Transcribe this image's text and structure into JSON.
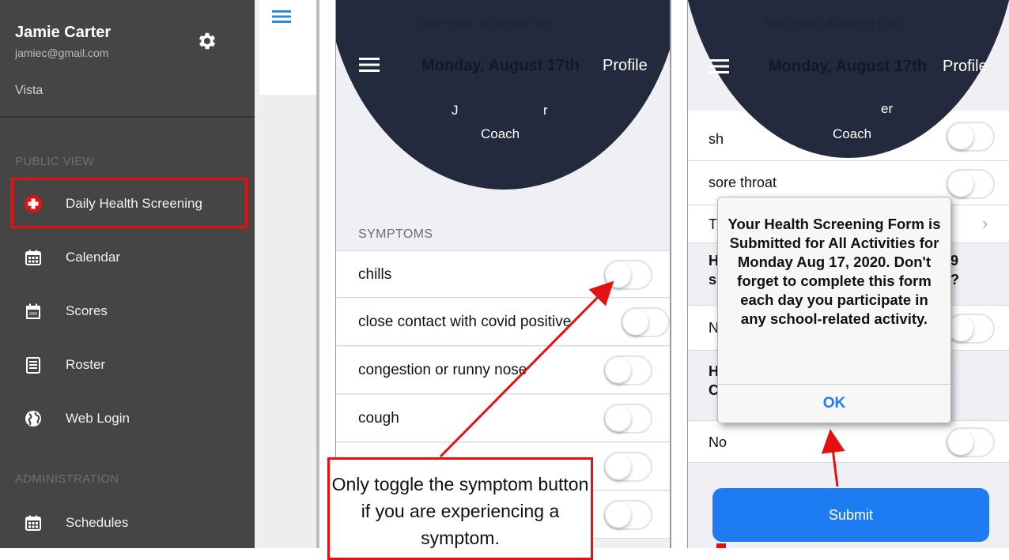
{
  "colors": {
    "sidebar_bg": "#454545",
    "header_navy": "#242a3e",
    "accent_red": "#e51010",
    "accent_blue": "#1e7cf2",
    "grouped_bg": "#efeff4"
  },
  "sidebar": {
    "user_name": "Jamie Carter",
    "user_email": "jamiec@gmail.com",
    "org": "Vista",
    "sections": [
      {
        "header": "PUBLIC VIEW"
      },
      {
        "header": "ADMINISTRATION"
      }
    ],
    "items": [
      {
        "label": "Daily Health Screening",
        "icon": "medical-cross-icon",
        "highlighted": true
      },
      {
        "label": "Calendar",
        "icon": "calendar-icon"
      },
      {
        "label": "Scores",
        "icon": "scores-calendar-icon"
      },
      {
        "label": "Roster",
        "icon": "roster-list-icon"
      },
      {
        "label": "Web Login",
        "icon": "globe-icon"
      },
      {
        "label": "Schedules",
        "icon": "schedules-calendar-icon"
      }
    ]
  },
  "screen2": {
    "form_title": "Daily Health Screening Form",
    "date": "Monday, August 17th",
    "profile": "Profile",
    "name_partial_left": "J",
    "name_partial_right": "r",
    "role": "Coach",
    "section_header": "SYMPTOMS",
    "symptoms": [
      {
        "label": "chills",
        "on": false
      },
      {
        "label": "close contact with covid positive",
        "on": false
      },
      {
        "label": "congestion or runny nose",
        "on": false
      },
      {
        "label": "cough",
        "on": false
      },
      {
        "label": "",
        "on": false
      },
      {
        "label": "",
        "on": false
      }
    ],
    "callout": "Only toggle the symptom button if you are experiencing a symptom."
  },
  "screen3": {
    "form_title": "Daily Health Screening Form",
    "date": "Monday, August 17th",
    "profile": "Profile",
    "name_partial": "er",
    "role": "Coach",
    "rows": {
      "row1_partial": "sh",
      "sore_throat": "sore throat",
      "row3_partial": "T",
      "q1_partial": "H",
      "q1_partial2": "s",
      "q1_right": "9",
      "q1_right2": "?",
      "answer1_partial": "N",
      "q2_partial": "H",
      "q2_partial2": "C",
      "answer2": "No"
    },
    "alert": {
      "message": "Your Health Screening Form is Submitted for All Activities for Monday Aug 17, 2020. Don't forget to complete this form each day you participate in any school-related activity.",
      "ok": "OK"
    },
    "submit": "Submit"
  }
}
